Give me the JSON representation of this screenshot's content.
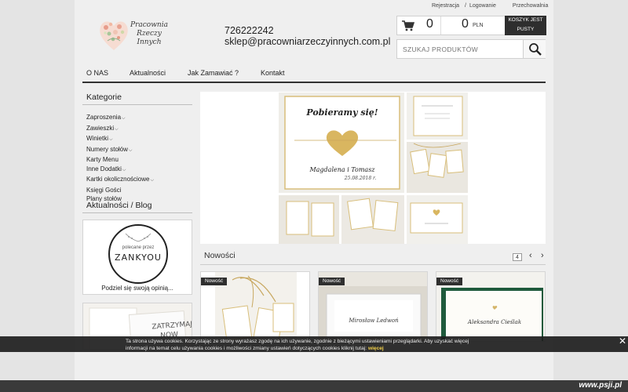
{
  "toplinks": {
    "register": "Rejestracja",
    "separator": "/",
    "login": "Logowanie",
    "store": "Przechowalnia"
  },
  "logo": {
    "line1": "Pracownia",
    "line2": "Rzeczy",
    "line3": "Innych",
    "icon": "heart-logo-icon"
  },
  "contact": {
    "phone": "726222242",
    "email": "sklep@pracowniarzeczyinnych.com.pl"
  },
  "cart": {
    "icon": "cart-icon",
    "count": "0",
    "sum": "0",
    "currency": "PLN",
    "status_line1": "KOSZYK JEST",
    "status_line2": "PUSTY"
  },
  "search": {
    "placeholder": "SZUKAJ PRODUKTÓW",
    "icon": "search-icon"
  },
  "nav": {
    "items": [
      "O NAS",
      "Aktualności",
      "Jak Zamawiać ?",
      "Kontakt"
    ]
  },
  "sidebar": {
    "categories_title": "Kategorie",
    "categories": [
      {
        "label": "Zaproszenia",
        "expand": "⌵"
      },
      {
        "label": "Zawieszki",
        "expand": "⌵"
      },
      {
        "label": "Winietki",
        "expand": "⌵"
      },
      {
        "label": "Numery stołów",
        "expand": "⌵"
      },
      {
        "label": "Karty Menu",
        "expand": ""
      },
      {
        "label": "Inne Dodatki",
        "expand": "⌵"
      },
      {
        "label": "Kartki okolicznościowe",
        "expand": "⌵"
      },
      {
        "label": "Księgi Gości",
        "expand": ""
      },
      {
        "label": "Plany stołów",
        "expand": ""
      }
    ],
    "blog_title": "Aktualności / Blog",
    "badge_small": "polecane przez",
    "badge_name": "ZANKYOU",
    "badge_caption": "Podziel się swoją opinią..."
  },
  "hero": {
    "card_title": "Pobieramy się!",
    "card_names": "Magdalena i Tomasz",
    "card_date": "25.08.2018 r."
  },
  "nowosci": {
    "title": "Nowości",
    "page": "4",
    "prev": "‹",
    "next": "›",
    "products": [
      {
        "badge": "Nowość",
        "card_text": ""
      },
      {
        "badge": "Nowość",
        "card_text": "Mirosław Ledwoń"
      },
      {
        "badge": "Nowość",
        "card_text": "Aleksandra Cieślak"
      }
    ]
  },
  "cookie": {
    "line1": "Ta strona używa cookies. Korzystając ze strony wyrażasz zgodę na ich używanie, zgodnie z bieżącymi ustawieniami przeglądarki. Aby uzyskać więcej",
    "line2": "informacji na temat celu używania cookies i możliwości zmiany ustawień dotyczących cookies kliknij tutaj:",
    "more": "więcej",
    "close": "✕"
  },
  "footer": {
    "watermark": "www.psji.pl"
  },
  "colors": {
    "page_bg": "#efefef",
    "outer_bg": "#e4e4e4",
    "dark": "#2e2e2e",
    "gold": "#d4b56a",
    "cookie_link": "#f2d04b"
  }
}
